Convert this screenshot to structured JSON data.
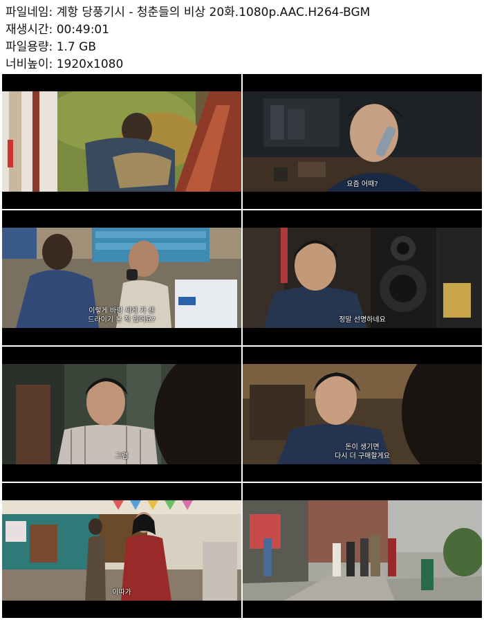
{
  "info": {
    "filename_label": "파일네임:",
    "filename": "계항 당풍기시 - 청춘들의 비상 20화.1080p.AAC.H264-BGM",
    "duration_label": "재생시간:",
    "duration": "00:49:01",
    "size_label": "파일용량:",
    "size": "1.7 GB",
    "resolution_label": "너비높이:",
    "resolution": "1920x1080"
  },
  "frames": [
    {
      "subtitle": ""
    },
    {
      "subtitle": "요즘 어때?"
    },
    {
      "subtitle_line1": "이렇게 바람 세게 가 센",
      "subtitle_line2": "드라이기 본 적 있어요?"
    },
    {
      "subtitle": "정말 선명하네요"
    },
    {
      "subtitle": "그럼"
    },
    {
      "subtitle_line1": "돈이 생기면",
      "subtitle_line2": "다시 더 구매할게요"
    },
    {
      "subtitle": "이따가"
    },
    {
      "subtitle": ""
    }
  ]
}
